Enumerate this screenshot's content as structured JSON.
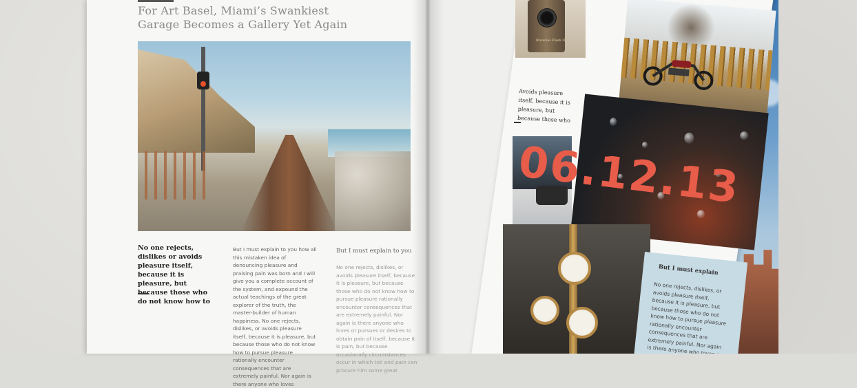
{
  "left_page": {
    "headline": "For Art Basel, Miami’s Swankiest Garage Becomes a Gallery Yet Again",
    "lead": "No one rejects, dislikes or avoids pleasure itself, because it is pleasure, but because those who do not know how to",
    "column_a": "But I must explain to you how all this mistaken idea of denouncing pleasure and praising pain was born and I will give you a complete account of the system, and expound the actual teachings of the great explorer of the truth, the master-builder of human happiness. No one rejects, dislikes, or avoids pleasure itself, because it is pleasure, but because those who do not know how to pursue pleasure rationally encounter consequences that are extremely painful. Nor again is there anyone who loves",
    "column_b_heading": "But I must explain to you",
    "column_b": "No one rejects, dislikes, or avoids pleasure itself, because it is pleasure, but because those who do not know how to pursue pleasure rationally encounter consequences that are extremely painful. Nor again is there anyone who loves or pursues or desires to obtain pain of itself, because it is pain, but because occasionally circumstances occur in which toil and pain can procure him some great"
  },
  "right_page": {
    "side_note": "Avoids pleasure itself, because it is pleasure, but because those who",
    "date": "06.12.13",
    "camera_label": "Brownie Flash II",
    "info_heading": "But I must explain",
    "info_body": "No one rejects, dislikes, or avoids pleasure itself, because it is pleasure, but because those who do not know how to pursue pleasure rationally encounter consequences that are extremely painful. Nor again is there anyone who loves or pursues or desires to obtain"
  },
  "colors": {
    "date_accent": "#e85c4a",
    "info_box": "#c7dbe4"
  }
}
